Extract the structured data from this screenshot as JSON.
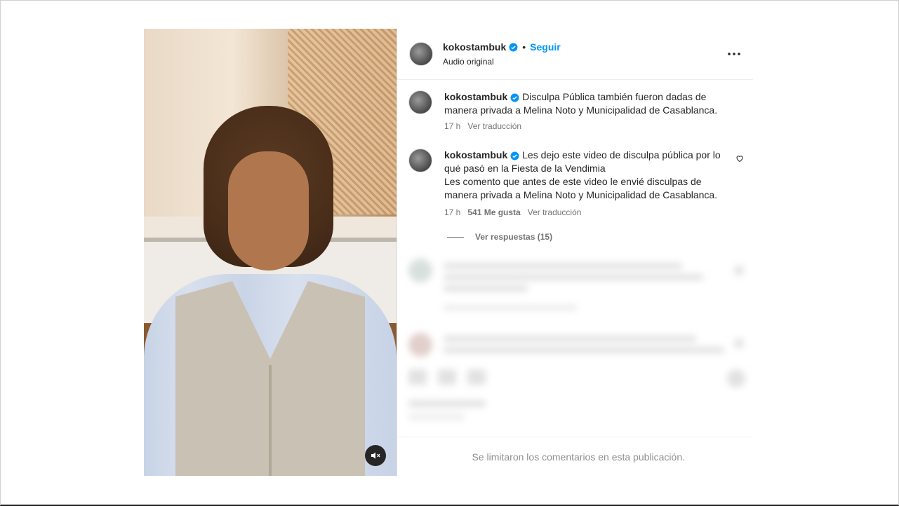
{
  "post": {
    "username": "kokostambuk",
    "separator": "•",
    "follow_label": "Seguir",
    "audio_label": "Audio original"
  },
  "comments": [
    {
      "username": "kokostambuk",
      "text": "Disculpa Pública también fueron dadas de manera privada a Melina Noto y Municipalidad de Casablanca.",
      "time": "17 h",
      "translate_label": "Ver traducción"
    },
    {
      "username": "kokostambuk",
      "text_line1": "Les dejo este video de disculpa pública por lo qué pasó en la Fiesta de la Vendimia",
      "text_line2": "Les comento que antes de este video le envié disculpas de manera privada a Melina Noto y Municipalidad de Casablanca.",
      "time": "17 h",
      "likes": "541 Me gusta",
      "translate_label": "Ver traducción"
    }
  ],
  "replies_label": "Ver respuestas (15)",
  "limited_comments_notice": "Se limitaron los comentarios en esta publicación.",
  "colors": {
    "link": "#0095f6",
    "verified": "#0095f6",
    "muted_text": "#737373"
  },
  "icons": [
    "verified-badge-icon",
    "more-options-icon",
    "heart-icon",
    "mute-icon"
  ]
}
